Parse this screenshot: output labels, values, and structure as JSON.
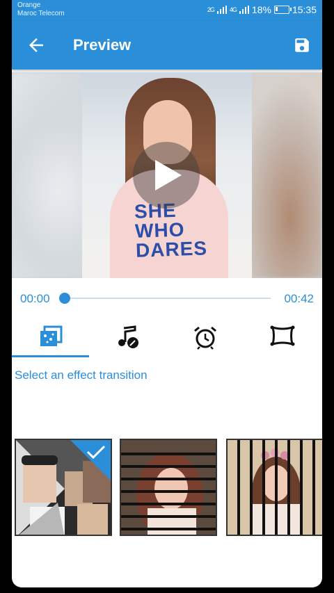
{
  "status_bar": {
    "carrier_1": "Orange",
    "carrier_2": "Maroc Telecom",
    "signal_1": "2G",
    "signal_2": "4G",
    "battery": "18%",
    "battery_level": 0.18,
    "time": "15:35"
  },
  "toolbar": {
    "title": "Preview",
    "back_icon": "arrow-left-icon",
    "save_icon": "save-icon"
  },
  "player": {
    "current_time": "00:00",
    "total_time": "00:42",
    "progress": 0.0,
    "play_icon": "play-icon",
    "photo_shirt_text": "SHE WHO DARES"
  },
  "tabs": [
    {
      "name": "transition",
      "icon": "transition-icon",
      "selected": true
    },
    {
      "name": "music",
      "icon": "music-icon",
      "selected": false
    },
    {
      "name": "duration",
      "icon": "alarm-clock-icon",
      "selected": false
    },
    {
      "name": "frame",
      "icon": "frame-icon",
      "selected": false
    }
  ],
  "hint": "Select an effect transition",
  "effects": [
    {
      "name": "collage",
      "selected": true
    },
    {
      "name": "horizontal-blinds",
      "selected": false
    },
    {
      "name": "vertical-blinds",
      "selected": false
    }
  ],
  "colors": {
    "accent": "#2a8fd8",
    "background": "#ffffff"
  }
}
